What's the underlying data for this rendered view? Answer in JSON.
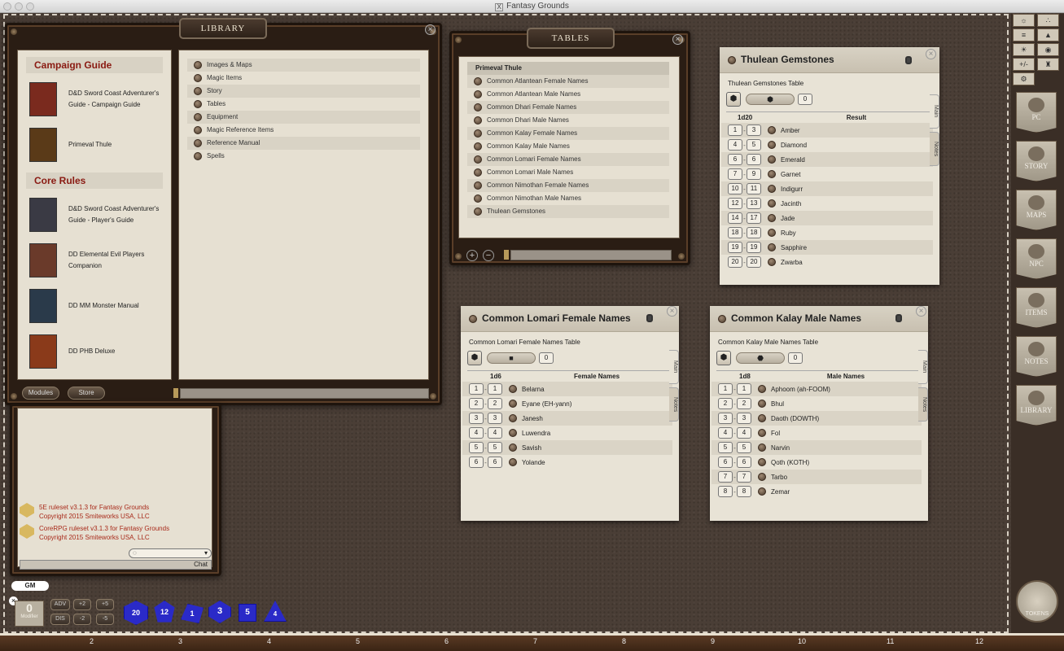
{
  "window": {
    "title": "Fantasy Grounds"
  },
  "library": {
    "title": "LIBRARY",
    "campaign_guide_header": "Campaign Guide",
    "core_rules_header": "Core Rules",
    "books": [
      {
        "name": "D&D Sword Coast Adventurer's Guide - Campaign Guide",
        "cover_color": "#7a2a1e"
      },
      {
        "name": "Primeval Thule",
        "cover_color": "#5a3a18"
      },
      {
        "name": "D&D Sword Coast Adventurer's Guide - Player's Guide",
        "cover_color": "#3a3a44"
      },
      {
        "name": "DD Elemental Evil Players Companion",
        "cover_color": "#6a3a2a"
      },
      {
        "name": "DD MM Monster Manual",
        "cover_color": "#2a3a4a"
      },
      {
        "name": "DD PHB Deluxe",
        "cover_color": "#8a3a1a"
      }
    ],
    "categories": [
      "Images & Maps",
      "Magic Items",
      "Story",
      "Tables",
      "Equipment",
      "Magic Reference Items",
      "Reference Manual",
      "Spells"
    ],
    "modules_label": "Modules",
    "store_label": "Store"
  },
  "tables": {
    "title": "TABLES",
    "group": "Primeval Thule",
    "items": [
      "Common Atlantean Female Names",
      "Common Atlantean Male Names",
      "Common Dhari Female Names",
      "Common Dhari Male Names",
      "Common Kalay Female Names",
      "Common Kalay Male Names",
      "Common Lomari Female Names",
      "Common Lomari Male Names",
      "Common Nimothan Female Names",
      "Common Nimothan Male Names",
      "Thulean Gemstones"
    ]
  },
  "gemstones": {
    "title": "Thulean Gemstones",
    "subtitle": "Thulean Gemstones Table",
    "count": "0",
    "die": "1d20",
    "result_header": "Result",
    "tab_main": "Main",
    "tab_notes": "Notes",
    "rows": [
      {
        "lo": "1",
        "hi": "3",
        "v": "Amber"
      },
      {
        "lo": "4",
        "hi": "5",
        "v": "Diamond"
      },
      {
        "lo": "6",
        "hi": "6",
        "v": "Emerald"
      },
      {
        "lo": "7",
        "hi": "9",
        "v": "Garnet"
      },
      {
        "lo": "10",
        "hi": "11",
        "v": "Indigurr"
      },
      {
        "lo": "12",
        "hi": "13",
        "v": "Jacinth"
      },
      {
        "lo": "14",
        "hi": "17",
        "v": "Jade"
      },
      {
        "lo": "18",
        "hi": "18",
        "v": "Ruby"
      },
      {
        "lo": "19",
        "hi": "19",
        "v": "Sapphire"
      },
      {
        "lo": "20",
        "hi": "20",
        "v": "Zwarba"
      }
    ]
  },
  "lomari": {
    "title": "Common Lomari Female Names",
    "subtitle": "Common Lomari Female Names Table",
    "count": "0",
    "die": "1d6",
    "result_header": "Female Names",
    "tab_main": "Main",
    "tab_notes": "Notes",
    "rows": [
      {
        "lo": "1",
        "hi": "1",
        "v": "Belarna"
      },
      {
        "lo": "2",
        "hi": "2",
        "v": "Eyane (EH-yann)"
      },
      {
        "lo": "3",
        "hi": "3",
        "v": "Janesh"
      },
      {
        "lo": "4",
        "hi": "4",
        "v": "Luwendra"
      },
      {
        "lo": "5",
        "hi": "5",
        "v": "Savish"
      },
      {
        "lo": "6",
        "hi": "6",
        "v": "Yolande"
      }
    ]
  },
  "kalay": {
    "title": "Common Kalay Male Names",
    "subtitle": "Common Kalay Male Names Table",
    "count": "0",
    "die": "1d8",
    "result_header": "Male Names",
    "tab_main": "Main",
    "tab_notes": "Notes",
    "rows": [
      {
        "lo": "1",
        "hi": "1",
        "v": "Aphoom (ah-FOOM)"
      },
      {
        "lo": "2",
        "hi": "2",
        "v": "Bhul"
      },
      {
        "lo": "3",
        "hi": "3",
        "v": "Daoth (DOWTH)"
      },
      {
        "lo": "4",
        "hi": "4",
        "v": "Fol"
      },
      {
        "lo": "5",
        "hi": "5",
        "v": "Narvin"
      },
      {
        "lo": "6",
        "hi": "6",
        "v": "Qoth (KOTH)"
      },
      {
        "lo": "7",
        "hi": "7",
        "v": "Tarbo"
      },
      {
        "lo": "8",
        "hi": "8",
        "v": "Zemar"
      }
    ]
  },
  "chat": {
    "messages": [
      {
        "line1": "5E ruleset v3.1.3 for Fantasy Grounds",
        "line2": "Copyright 2015 Smiteworks USA, LLC"
      },
      {
        "line1": "CoreRPG ruleset v3.1.3 for Fantasy Grounds",
        "line2": "Copyright 2015 Smiteworks USA, LLC"
      }
    ],
    "send_label": "Chat"
  },
  "dice_bar": {
    "gm_label": "GM",
    "modifier_value": "0",
    "modifier_label": "Modifier",
    "adv": "ADV",
    "dis": "DIS",
    "plus2": "+2",
    "plus5": "+5",
    "minus2": "-2",
    "minus5": "-5",
    "dice": [
      "20",
      "12",
      "1",
      "3",
      "5",
      "4"
    ]
  },
  "sidebar": {
    "buttons": [
      "PC",
      "STORY",
      "MAPS",
      "NPC",
      "ITEMS",
      "NOTES",
      "LIBRARY"
    ],
    "small_buttons": [
      "☼",
      "∴",
      "≡",
      "▲",
      "☀",
      "◉",
      "+/-",
      "♜",
      "⚙"
    ],
    "tokens_label": "TOKENS"
  },
  "ruler": [
    "2",
    "3",
    "4",
    "5",
    "6",
    "7",
    "8",
    "9",
    "10",
    "11",
    "12"
  ],
  "colors": {
    "accent": "#8a1a12",
    "dice": "#2a2ac8",
    "chat_text": "#a82a1a"
  }
}
